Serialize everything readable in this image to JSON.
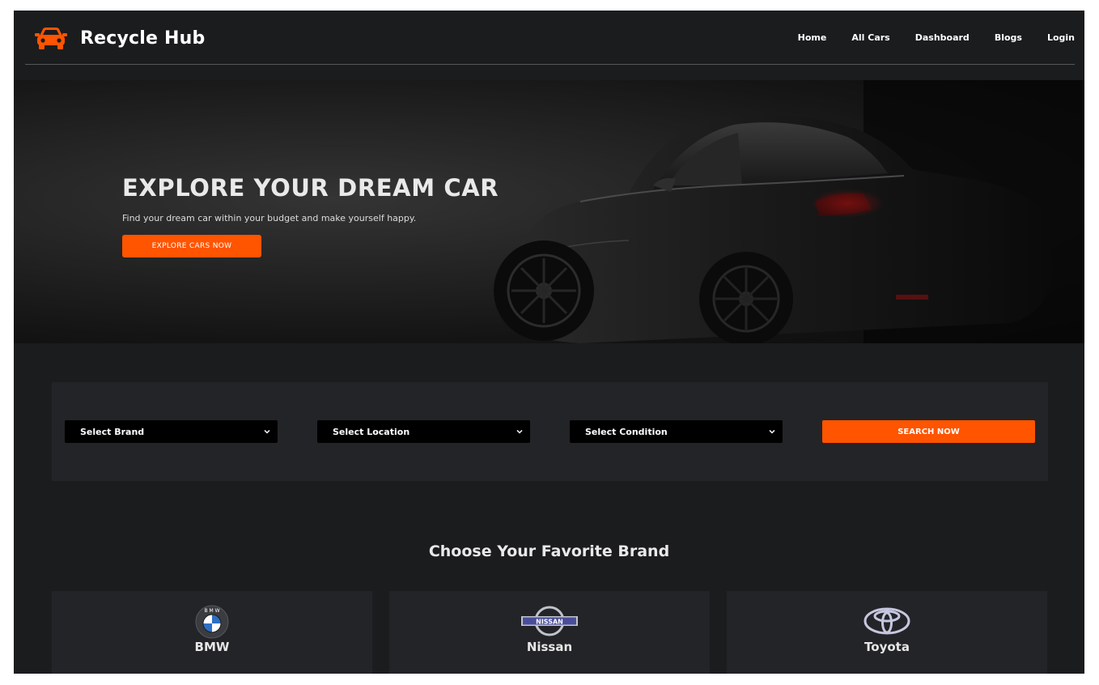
{
  "header": {
    "app_name": "Recycle Hub",
    "logo_icon": "car-front-icon",
    "nav": [
      {
        "label": "Home"
      },
      {
        "label": "All Cars"
      },
      {
        "label": "Dashboard"
      },
      {
        "label": "Blogs"
      },
      {
        "label": "Login"
      }
    ]
  },
  "hero": {
    "title": "EXPLORE YOUR DREAM CAR",
    "subtitle": "Find your dream car within your budget and make yourself happy.",
    "cta_label": "EXPLORE CARS NOW"
  },
  "search": {
    "brand_select": "Select Brand",
    "location_select": "Select Location",
    "condition_select": "Select Condition",
    "search_label": "SEARCH NOW"
  },
  "brands": {
    "title": "Choose Your Favorite Brand",
    "items": [
      {
        "label": "BMW",
        "icon": "bmw-logo-icon",
        "logo_text": "B M W"
      },
      {
        "label": "Nissan",
        "icon": "nissan-logo-icon",
        "logo_text": "NISSAN"
      },
      {
        "label": "Toyota",
        "icon": "toyota-logo-icon"
      }
    ]
  },
  "colors": {
    "accent": "#ff5400",
    "page_bg": "#1b1c1e",
    "panel_bg": "#232427"
  }
}
